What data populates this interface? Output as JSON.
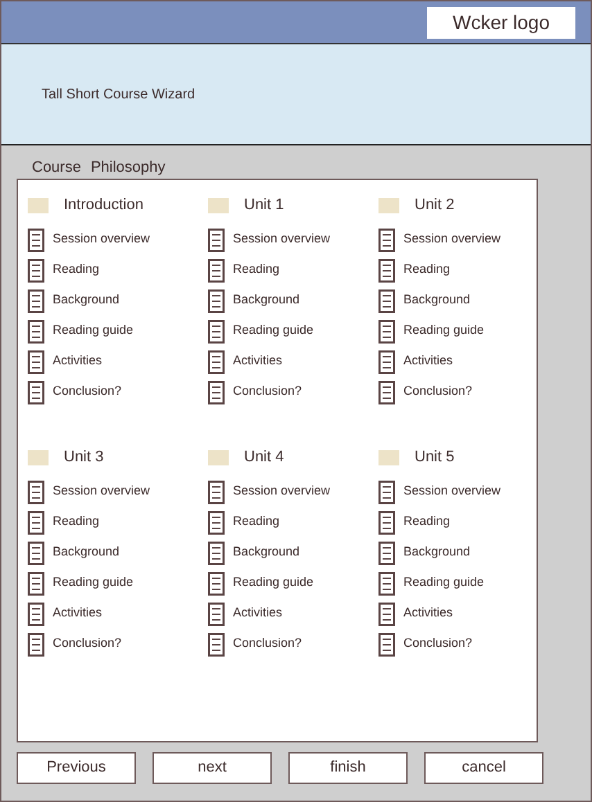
{
  "header": {
    "logo": "Wcker logo"
  },
  "banner": {
    "title": "Tall Short Course Wizard"
  },
  "tabs": [
    {
      "label": "Course"
    },
    {
      "label": "Philosophy"
    }
  ],
  "units": [
    {
      "title": "Introduction",
      "items": [
        "Session overview",
        "Reading",
        "Background",
        "Reading guide",
        "Activities",
        "Conclusion?"
      ]
    },
    {
      "title": "Unit 1",
      "items": [
        "Session overview",
        "Reading",
        "Background",
        "Reading guide",
        "Activities",
        "Conclusion?"
      ]
    },
    {
      "title": "Unit 2",
      "items": [
        "Session overview",
        "Reading",
        "Background",
        "Reading guide",
        "Activities",
        "Conclusion?"
      ]
    },
    {
      "title": "Unit 3",
      "items": [
        "Session overview",
        "Reading",
        "Background",
        "Reading guide",
        "Activities",
        "Conclusion?"
      ]
    },
    {
      "title": "Unit 4",
      "items": [
        "Session overview",
        "Reading",
        "Background",
        "Reading guide",
        "Activities",
        "Conclusion?"
      ]
    },
    {
      "title": "Unit 5",
      "items": [
        "Session overview",
        "Reading",
        "Background",
        "Reading guide",
        "Activities",
        "Conclusion?"
      ]
    }
  ],
  "buttons": [
    "Previous",
    "next",
    "finish",
    "cancel"
  ]
}
